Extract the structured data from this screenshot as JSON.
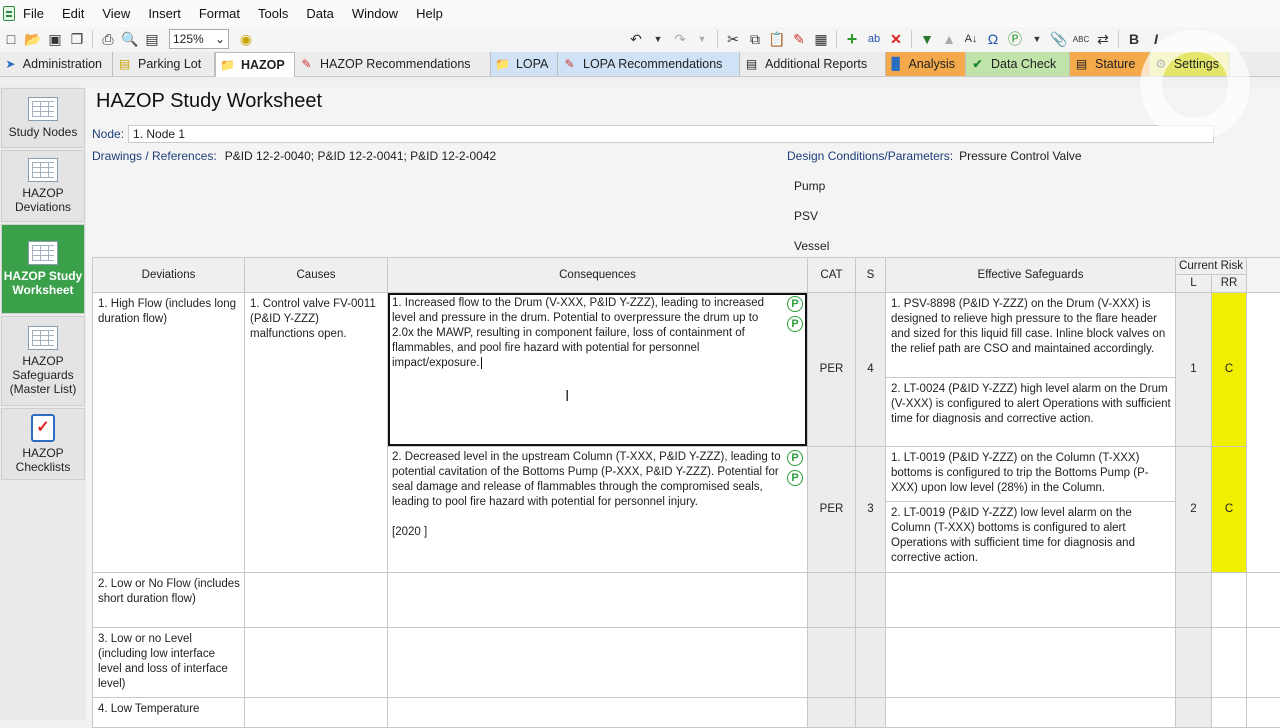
{
  "menu": [
    "File",
    "Edit",
    "View",
    "Insert",
    "Format",
    "Tools",
    "Data",
    "Window",
    "Help"
  ],
  "toolbar": {
    "zoom": "125%"
  },
  "tabs": [
    {
      "label": "Administration",
      "icon": "arrow-icon",
      "style": ""
    },
    {
      "label": "Parking Lot",
      "icon": "lot-icon",
      "style": ""
    },
    {
      "label": "HAZOP",
      "icon": "folder-icon",
      "style": "active"
    },
    {
      "label": "HAZOP Recommendations",
      "icon": "pencil-icon",
      "style": ""
    },
    {
      "label": "LOPA",
      "icon": "folder-icon",
      "style": "blue"
    },
    {
      "label": "LOPA Recommendations",
      "icon": "pencil-icon",
      "style": "blue"
    },
    {
      "label": "Additional Reports",
      "icon": "report-icon",
      "style": ""
    },
    {
      "label": "Analysis",
      "icon": "bar-chart-icon",
      "style": "orange"
    },
    {
      "label": "Data Check",
      "icon": "check-icon",
      "style": "green"
    },
    {
      "label": "Stature",
      "icon": "stature-icon",
      "style": "orange"
    },
    {
      "label": "Settings",
      "icon": "settings-icon",
      "style": "yellow"
    }
  ],
  "sidebar": [
    {
      "label": "Study Nodes"
    },
    {
      "label": "HAZOP Deviations"
    },
    {
      "label": "HAZOP Study Worksheet"
    },
    {
      "label": "HAZOP Safeguards (Master List)"
    },
    {
      "label": "HAZOP Checklists"
    }
  ],
  "worksheet": {
    "title": "HAZOP Study Worksheet",
    "node_label": "Node:",
    "node_value": "1. Node 1",
    "drawings_label": "Drawings / References:",
    "drawings_value": "P&ID 12-2-0040; P&ID 12-2-0041; P&ID 12-2-0042",
    "design_label": "Design Conditions/Parameters:",
    "design_value": "Pressure Control Valve",
    "equipment": [
      "Pump",
      "PSV",
      "Vessel"
    ]
  },
  "columns": {
    "deviations": "Deviations",
    "causes": "Causes",
    "consequences": "Consequences",
    "cat": "CAT",
    "s": "S",
    "safeguards": "Effective Safeguards",
    "current_risk": "Current Risk",
    "l": "L",
    "rr": "RR"
  },
  "rows": {
    "dev1": "1. High Flow (includes long duration flow)",
    "cause1": "1. Control valve FV-0011 (P&ID Y-ZZZ) malfunctions open.",
    "cons1": "1. Increased flow to the Drum (V-XXX, P&ID Y-ZZZ), leading to increased level and pressure in the drum. Potential to overpressure the drum up to 2.0x the MAWP, resulting in component failure, loss of containment of flammables, and pool fire hazard with potential for personnel impact/exposure.",
    "cons1_cat": "PER",
    "cons1_s": "4",
    "cons1_l": "1",
    "cons1_rr": "C",
    "sg1a": "1. PSV-8898 (P&ID Y-ZZZ) on the Drum (V-XXX) is designed to relieve high pressure to the flare header and sized for this liquid fill case. Inline block valves on the relief path are CSO and maintained accordingly.",
    "sg1b": "2. LT-0024 (P&ID Y-ZZZ) high level alarm on the Drum (V-XXX) is configured to alert Operations with sufficient time for diagnosis and corrective action.",
    "cons2": "2. Decreased level in the upstream Column (T-XXX, P&ID Y-ZZZ), leading to potential cavitation of the Bottoms Pump (P-XXX, P&ID Y-ZZZ). Potential for seal damage and release of flammables through the compromised seals, leading to pool fire hazard with potential for personnel injury.",
    "cons2_note": "[2020 ]",
    "cons2_cat": "PER",
    "cons2_s": "3",
    "cons2_l": "2",
    "cons2_rr": "C",
    "sg2a": "1. LT-0019 (P&ID Y-ZZZ) on the Column (T-XXX) bottoms is configured to trip the Bottoms Pump (P-XXX) upon low level (28%) in the Column.",
    "sg2b": "2. LT-0019 (P&ID Y-ZZZ) low level alarm on the Column (T-XXX) bottoms is configured to alert Operations with sufficient time for diagnosis and corrective action.",
    "dev2": "2. Low or No Flow (includes short duration flow)",
    "dev3": "3. Low or no Level (including low interface level and loss of interface level)",
    "dev4": "4. Low Temperature"
  },
  "badges": {
    "p": "P"
  },
  "colors": {
    "active_green": "#3aa04a",
    "rr_yellow": "#f0f000",
    "label_blue": "#1f3f7a"
  }
}
